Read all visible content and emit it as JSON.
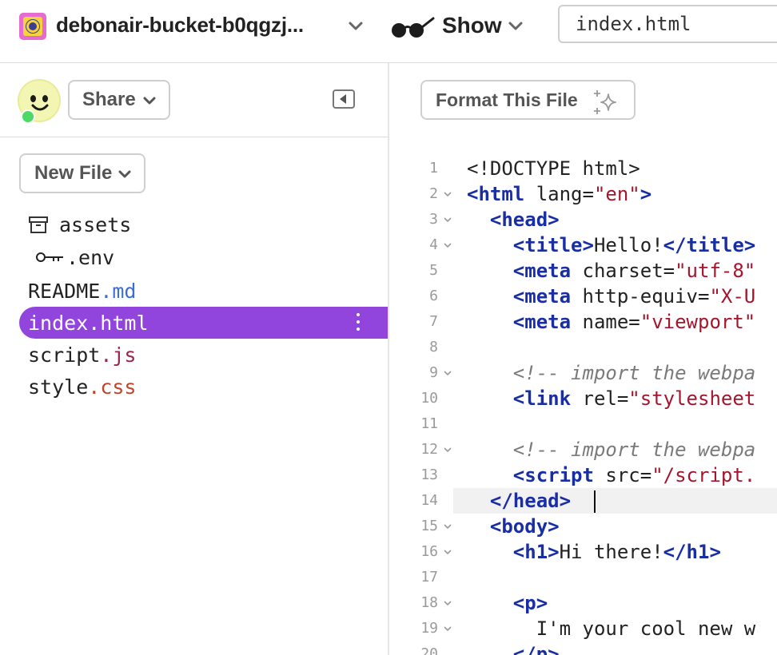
{
  "topbar": {
    "project_name": "debonair-bucket-b0qgzj...",
    "show_label": "Show",
    "file_search_value": "index.html",
    "icons": {
      "project_logo": "project-logo-icon",
      "project_menu": "chevron-down-icon",
      "show_glasses": "glasses-icon",
      "show_menu": "chevron-down-icon"
    }
  },
  "sidebar": {
    "share_label": "Share",
    "new_file_label": "New File",
    "colors": {
      "active_item_bg": "#9245dd",
      "online_dot": "#4cd964",
      "avatar_bg": "#f3f6b2"
    },
    "files": [
      {
        "name": "assets",
        "ext": "",
        "icon": "folder-archive-icon"
      },
      {
        "name": ".env",
        "ext": "",
        "icon": "key-icon"
      },
      {
        "name": "README",
        "ext": ".md"
      },
      {
        "name": "index.html",
        "ext": "",
        "active": true
      },
      {
        "name": "script",
        "ext": ".js"
      },
      {
        "name": "style",
        "ext": ".css"
      }
    ]
  },
  "editor": {
    "format_label": "Format This File",
    "current_line": 14,
    "line_numbers": [
      "1",
      "2",
      "3",
      "4",
      "5",
      "6",
      "7",
      "8",
      "9",
      "10",
      "11",
      "12",
      "13",
      "14",
      "15",
      "16",
      "17",
      "18",
      "19",
      "20"
    ],
    "lines": [
      [
        [
          "p",
          "<!DOCTYPE html>"
        ]
      ],
      [
        [
          "t",
          "<html"
        ],
        [
          "p",
          " lang="
        ],
        [
          "s",
          "\"en\""
        ],
        [
          "t",
          ">"
        ]
      ],
      [
        [
          "p",
          "  "
        ],
        [
          "t",
          "<head>"
        ]
      ],
      [
        [
          "p",
          "    "
        ],
        [
          "t",
          "<title>"
        ],
        [
          "p",
          "Hello!"
        ],
        [
          "t",
          "</title>"
        ]
      ],
      [
        [
          "p",
          "    "
        ],
        [
          "t",
          "<meta"
        ],
        [
          "p",
          " charset="
        ],
        [
          "s",
          "\"utf-8\""
        ]
      ],
      [
        [
          "p",
          "    "
        ],
        [
          "t",
          "<meta"
        ],
        [
          "p",
          " http-equiv="
        ],
        [
          "s",
          "\"X-U"
        ]
      ],
      [
        [
          "p",
          "    "
        ],
        [
          "t",
          "<meta"
        ],
        [
          "p",
          " name="
        ],
        [
          "s",
          "\"viewport\""
        ]
      ],
      [],
      [
        [
          "p",
          "    "
        ],
        [
          "c",
          "<!-- import the webpa"
        ]
      ],
      [
        [
          "p",
          "    "
        ],
        [
          "t",
          "<link"
        ],
        [
          "p",
          " rel="
        ],
        [
          "s",
          "\"stylesheet"
        ]
      ],
      [],
      [
        [
          "p",
          "    "
        ],
        [
          "c",
          "<!-- import the webpa"
        ]
      ],
      [
        [
          "p",
          "    "
        ],
        [
          "t",
          "<script"
        ],
        [
          "p",
          " src="
        ],
        [
          "s",
          "\"/script."
        ]
      ],
      [
        [
          "p",
          "  "
        ],
        [
          "t",
          "</head>"
        ],
        [
          "p",
          "  "
        ]
      ],
      [
        [
          "p",
          "  "
        ],
        [
          "t",
          "<body>"
        ]
      ],
      [
        [
          "p",
          "    "
        ],
        [
          "t",
          "<h1>"
        ],
        [
          "p",
          "Hi there!"
        ],
        [
          "t",
          "</h1>"
        ]
      ],
      [],
      [
        [
          "p",
          "    "
        ],
        [
          "t",
          "<p>"
        ]
      ],
      [
        [
          "p",
          "      I'm your cool new w"
        ]
      ],
      [
        [
          "p",
          "    "
        ],
        [
          "t",
          "</p>"
        ]
      ]
    ],
    "foldable": [
      2,
      3,
      4,
      9,
      12,
      15,
      16,
      18,
      19
    ]
  }
}
